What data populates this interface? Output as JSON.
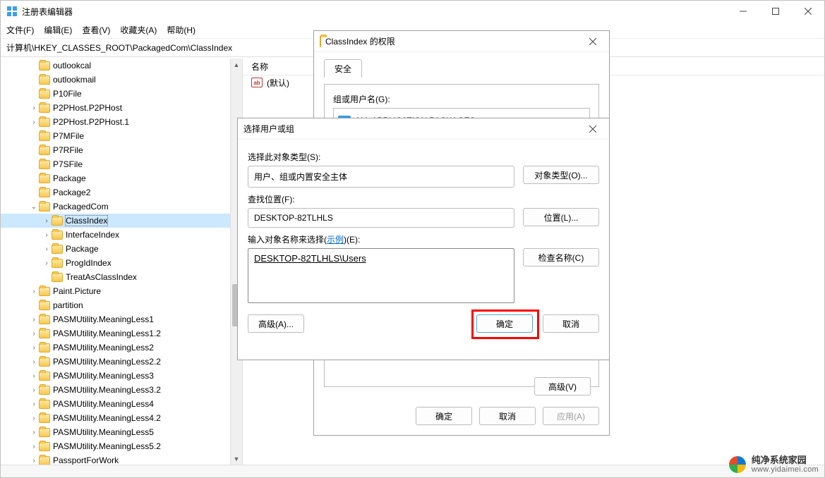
{
  "window": {
    "title": "注册表编辑器",
    "address": "计算机\\HKEY_CLASSES_ROOT\\PackagedCom\\ClassIndex"
  },
  "menus": {
    "file": "文件(F)",
    "edit": "编辑(E)",
    "view": "查看(V)",
    "favorites": "收藏夹(A)",
    "help": "帮助(H)"
  },
  "tree": {
    "items": [
      {
        "indent": 2,
        "expander": "",
        "label": "outlookcal"
      },
      {
        "indent": 2,
        "expander": "",
        "label": "outlookmail"
      },
      {
        "indent": 2,
        "expander": "",
        "label": "P10File"
      },
      {
        "indent": 2,
        "expander": ">",
        "label": "P2PHost.P2PHost"
      },
      {
        "indent": 2,
        "expander": ">",
        "label": "P2PHost.P2PHost.1"
      },
      {
        "indent": 2,
        "expander": "",
        "label": "P7MFile"
      },
      {
        "indent": 2,
        "expander": "",
        "label": "P7RFile"
      },
      {
        "indent": 2,
        "expander": "",
        "label": "P7SFile"
      },
      {
        "indent": 2,
        "expander": "",
        "label": "Package"
      },
      {
        "indent": 2,
        "expander": "",
        "label": "Package2"
      },
      {
        "indent": 2,
        "expander": "v",
        "label": "PackagedCom"
      },
      {
        "indent": 3,
        "expander": ">",
        "label": "ClassIndex",
        "selected": true
      },
      {
        "indent": 3,
        "expander": ">",
        "label": "InterfaceIndex"
      },
      {
        "indent": 3,
        "expander": ">",
        "label": "Package"
      },
      {
        "indent": 3,
        "expander": ">",
        "label": "ProgIdIndex"
      },
      {
        "indent": 3,
        "expander": "",
        "label": "TreatAsClassIndex"
      },
      {
        "indent": 2,
        "expander": ">",
        "label": "Paint.Picture"
      },
      {
        "indent": 2,
        "expander": "",
        "label": "partition"
      },
      {
        "indent": 2,
        "expander": ">",
        "label": "PASMUtility.MeaningLess1"
      },
      {
        "indent": 2,
        "expander": ">",
        "label": "PASMUtility.MeaningLess1.2"
      },
      {
        "indent": 2,
        "expander": ">",
        "label": "PASMUtility.MeaningLess2"
      },
      {
        "indent": 2,
        "expander": ">",
        "label": "PASMUtility.MeaningLess2.2"
      },
      {
        "indent": 2,
        "expander": ">",
        "label": "PASMUtility.MeaningLess3"
      },
      {
        "indent": 2,
        "expander": ">",
        "label": "PASMUtility.MeaningLess3.2"
      },
      {
        "indent": 2,
        "expander": ">",
        "label": "PASMUtility.MeaningLess4"
      },
      {
        "indent": 2,
        "expander": ">",
        "label": "PASMUtility.MeaningLess4.2"
      },
      {
        "indent": 2,
        "expander": ">",
        "label": "PASMUtility.MeaningLess5"
      },
      {
        "indent": 2,
        "expander": ">",
        "label": "PASMUtility.MeaningLess5.2"
      },
      {
        "indent": 2,
        "expander": ">",
        "label": "PassportForWork"
      }
    ]
  },
  "value_list": {
    "header_name": "名称",
    "default_label": "(默认)",
    "string_glyph": "ab"
  },
  "permissions_dialog": {
    "title_prefix": "ClassIndex 的权限",
    "tab_security": "安全",
    "groups_label": "组或用户名(G):",
    "group_item": "ALL APPLICATION PACKAGES",
    "advanced_btn": "高级(V)",
    "ok": "确定",
    "cancel": "取消",
    "apply": "应用(A)"
  },
  "select_dialog": {
    "title": "选择用户或组",
    "obj_type_label": "选择此对象类型(S):",
    "obj_type_value": "用户、组或内置安全主体",
    "obj_type_btn": "对象类型(O)...",
    "location_label": "查找位置(F):",
    "location_value": "DESKTOP-82TLHLS",
    "location_btn": "位置(L)...",
    "names_label_pre": "输入对象名称来选择(",
    "names_label_link": "示例",
    "names_label_post": ")(E):",
    "names_value": "DESKTOP-82TLHLS\\Users",
    "check_btn": "检查名称(C)",
    "advanced_btn": "高级(A)...",
    "ok": "确定",
    "cancel": "取消"
  },
  "watermark": {
    "line1": "纯净系统家园",
    "line2": "www.yidaimei.com"
  },
  "folder_icon_color": "#f6c94f"
}
